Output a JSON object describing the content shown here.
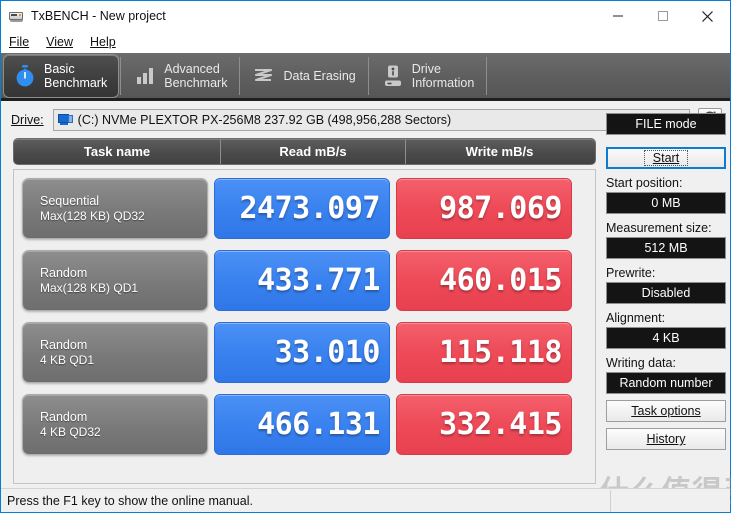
{
  "window": {
    "title": "TxBENCH - New project",
    "icon": "drive-icon",
    "minimize_label": "–",
    "maximize_label": "□",
    "close_label": "×"
  },
  "menu": {
    "items": [
      {
        "label": "File",
        "accel": "F"
      },
      {
        "label": "View",
        "accel": "V"
      },
      {
        "label": "Help",
        "accel": "H"
      }
    ]
  },
  "tabs": [
    {
      "label": "Basic\nBenchmark",
      "icon": "stopwatch-icon",
      "active": true
    },
    {
      "label": "Advanced\nBenchmark",
      "icon": "bar-chart-icon",
      "active": false
    },
    {
      "label": "Data Erasing",
      "icon": "eraser-wave-icon",
      "active": false
    },
    {
      "label": "Drive\nInformation",
      "icon": "drive-info-icon",
      "active": false
    }
  ],
  "drive": {
    "label": "Drive:",
    "label_accel": "D",
    "selected": "(C:) NVMe PLEXTOR PX-256M8  237.92 GB (498,956,288 Sectors)",
    "icon": "drive-select-icon",
    "dropdown_icon": "chevron-down-icon",
    "refresh_icon": "refresh-icon"
  },
  "results": {
    "columns": [
      "Task name",
      "Read mB/s",
      "Write mB/s"
    ],
    "rows": [
      {
        "task_line1": "Sequential",
        "task_line2": "Max(128 KB) QD32",
        "read": "2473.097",
        "write": "987.069"
      },
      {
        "task_line1": "Random",
        "task_line2": "Max(128 KB) QD1",
        "read": "433.771",
        "write": "460.015"
      },
      {
        "task_line1": "Random",
        "task_line2": "4 KB QD1",
        "read": "33.010",
        "write": "115.118"
      },
      {
        "task_line1": "Random",
        "task_line2": "4 KB QD32",
        "read": "466.131",
        "write": "332.415"
      }
    ]
  },
  "sidebar": {
    "mode_value": "FILE mode",
    "start_label": "Start",
    "start_accel": "S",
    "start_position_caption": "Start position:",
    "start_position_value": "0 MB",
    "measurement_caption": "Measurement size:",
    "measurement_value": "512 MB",
    "prewrite_caption": "Prewrite:",
    "prewrite_value": "Disabled",
    "alignment_caption": "Alignment:",
    "alignment_value": "4 KB",
    "writing_data_caption": "Writing data:",
    "writing_data_value": "Random number",
    "task_options_label": "Task options",
    "task_options_accel": "T",
    "history_label": "History",
    "history_accel": "s"
  },
  "statusbar": {
    "text": "Press the F1 key to show the online manual."
  },
  "watermark": {
    "text": "什么值得买"
  },
  "colors": {
    "read_badge": "#3a82ef",
    "write_badge": "#ee4a58",
    "tab_strip": "#5e5e5e",
    "accent_blue": "#0a7cd4",
    "dark_field": "#141414"
  }
}
